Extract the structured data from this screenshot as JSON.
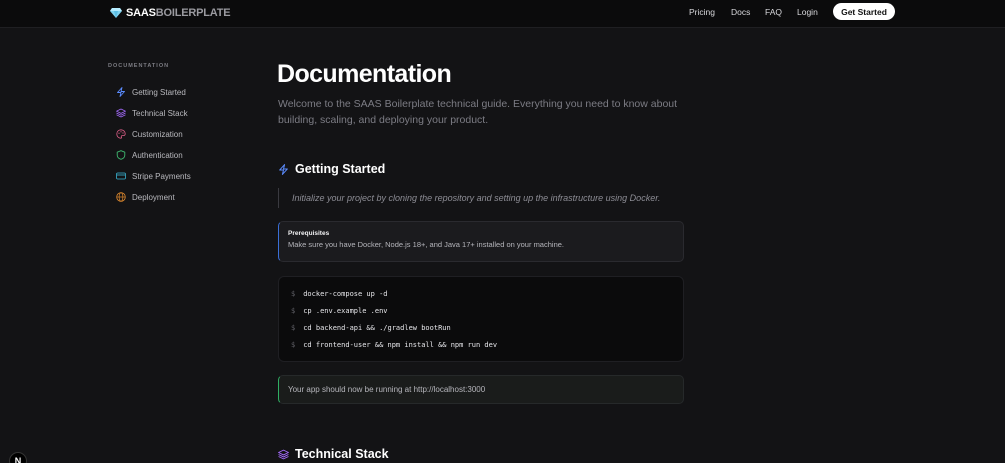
{
  "brand": {
    "part1": "SAAS",
    "part2": "BOILERPLATE"
  },
  "nav": {
    "links": [
      "Pricing",
      "Docs",
      "FAQ",
      "Login"
    ],
    "cta": "Get Started"
  },
  "sidebar": {
    "heading": "DOCUMENTATION",
    "items": [
      {
        "label": "Getting Started",
        "icon": "bolt-icon",
        "color": "#5b8cff"
      },
      {
        "label": "Technical Stack",
        "icon": "layers-icon",
        "color": "#a66cff"
      },
      {
        "label": "Customization",
        "icon": "palette-icon",
        "color": "#e0608a"
      },
      {
        "label": "Authentication",
        "icon": "shield-icon",
        "color": "#3fb970"
      },
      {
        "label": "Stripe Payments",
        "icon": "credit-card-icon",
        "color": "#3ab7d6"
      },
      {
        "label": "Deployment",
        "icon": "globe-icon",
        "color": "#e08a2e"
      }
    ]
  },
  "main": {
    "title": "Documentation",
    "lead": "Welcome to the SAAS Boilerplate technical guide. Everything you need to know about building, scaling, and deploying your product.",
    "sections": [
      {
        "heading": "Getting Started",
        "icon": "bolt-icon"
      },
      {
        "heading": "Technical Stack",
        "icon": "layers-icon"
      }
    ],
    "intro": "Initialize your project by cloning the repository and setting up the infrastructure using Docker.",
    "callout": {
      "title": "Prerequisites",
      "body": "Make sure you have Docker, Node.js 18+, and Java 17+ installed on your machine."
    },
    "code": {
      "prompt": "$",
      "lines": [
        "docker-compose up -d",
        "cp .env.example .env",
        "cd backend-api && ./gradlew bootRun",
        "cd frontend-user && npm install && npm run dev"
      ]
    },
    "success": "Your app should now be running at http://localhost:3000"
  },
  "badge": "N"
}
